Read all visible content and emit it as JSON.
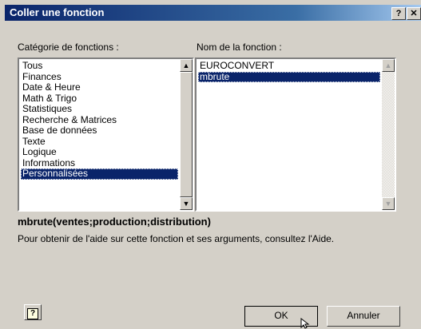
{
  "dialog": {
    "title": "Coller une fonction",
    "help_glyph": "?",
    "close_glyph": "✕"
  },
  "category": {
    "label": "Catégorie de fonctions :",
    "items": [
      "Tous",
      "Finances",
      "Date & Heure",
      "Math & Trigo",
      "Statistiques",
      "Recherche & Matrices",
      "Base de données",
      "Texte",
      "Logique",
      "Informations",
      "Personnalisées"
    ],
    "selected": "Personnalisées"
  },
  "functions": {
    "label": "Nom de la fonction :",
    "items": [
      "EUROCONVERT",
      "mbrute"
    ],
    "selected": "mbrute"
  },
  "signature": "mbrute(ventes;production;distribution)",
  "description": "Pour obtenir de l'aide sur cette fonction et ses arguments, consultez l'Aide.",
  "buttons": {
    "ok": "OK",
    "cancel": "Annuler",
    "help_icon": "?"
  },
  "scroll_glyphs": {
    "up": "▲",
    "down": "▼"
  }
}
